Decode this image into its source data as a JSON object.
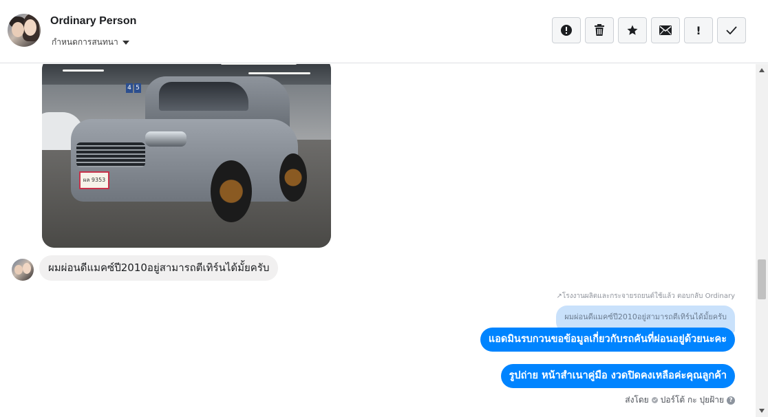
{
  "header": {
    "name": "Ordinary Person",
    "conversation_setting": "กำหนดการสนทนา",
    "toolbar": [
      {
        "icon": "alert-circle-icon"
      },
      {
        "icon": "trash-icon"
      },
      {
        "icon": "star-icon"
      },
      {
        "icon": "envelope-icon"
      },
      {
        "icon": "exclamation-icon",
        "glyph": "!"
      },
      {
        "icon": "checkmark-icon"
      }
    ]
  },
  "thread": {
    "photo": {
      "plate_text": "ผล 9353",
      "bay_signs": [
        "4",
        "5"
      ]
    },
    "incoming_message": "ผมผ่อนดีแมคซ์ปี2010อยู่สามารถตีเทิร์นได้มั้ยครับ",
    "reply_note": "↗โรงงานผลิตและกระจายรถยนต์ใช้แล้ว ตอบกลับ Ordinary",
    "quoted_message": "ผมผ่อนดีแมคซ์ปี2010อยู่สามารถตีเทิร์นได้มั้ยครับ",
    "outgoing_messages": [
      "แอดมินรบกวนขอข้อมูลเกี่ยวกับรถคันที่ผ่อนอยู่ด้วยนะคะ",
      "รูปถ่าย หน้าสำเนาคู่มือ งวดปิดคงเหลือค่ะคุณลูกค้า"
    ],
    "sent_by_label": "ส่งโดย",
    "sent_by_name": "ปอร์โต้ กะ ปุยฝ้าย",
    "help_glyph": "?"
  },
  "colors": {
    "outgoing_bubble": "#0084ff",
    "quoted_bubble": "#c9e1fb",
    "incoming_bubble": "#f1f0f0"
  }
}
